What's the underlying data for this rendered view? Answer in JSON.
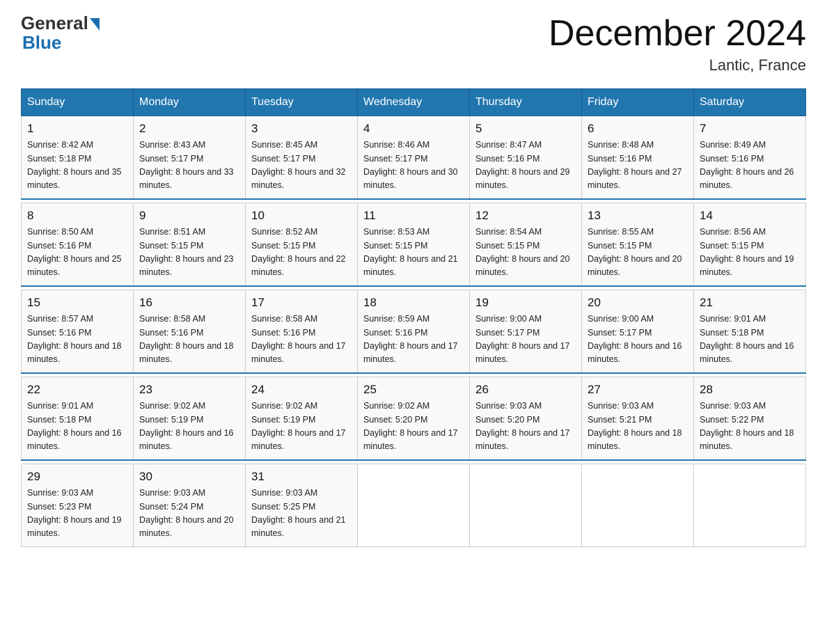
{
  "logo": {
    "general": "General",
    "blue": "Blue"
  },
  "title": "December 2024",
  "subtitle": "Lantic, France",
  "days_header": [
    "Sunday",
    "Monday",
    "Tuesday",
    "Wednesday",
    "Thursday",
    "Friday",
    "Saturday"
  ],
  "weeks": [
    [
      {
        "num": "1",
        "sunrise": "8:42 AM",
        "sunset": "5:18 PM",
        "daylight": "8 hours and 35 minutes."
      },
      {
        "num": "2",
        "sunrise": "8:43 AM",
        "sunset": "5:17 PM",
        "daylight": "8 hours and 33 minutes."
      },
      {
        "num": "3",
        "sunrise": "8:45 AM",
        "sunset": "5:17 PM",
        "daylight": "8 hours and 32 minutes."
      },
      {
        "num": "4",
        "sunrise": "8:46 AM",
        "sunset": "5:17 PM",
        "daylight": "8 hours and 30 minutes."
      },
      {
        "num": "5",
        "sunrise": "8:47 AM",
        "sunset": "5:16 PM",
        "daylight": "8 hours and 29 minutes."
      },
      {
        "num": "6",
        "sunrise": "8:48 AM",
        "sunset": "5:16 PM",
        "daylight": "8 hours and 27 minutes."
      },
      {
        "num": "7",
        "sunrise": "8:49 AM",
        "sunset": "5:16 PM",
        "daylight": "8 hours and 26 minutes."
      }
    ],
    [
      {
        "num": "8",
        "sunrise": "8:50 AM",
        "sunset": "5:16 PM",
        "daylight": "8 hours and 25 minutes."
      },
      {
        "num": "9",
        "sunrise": "8:51 AM",
        "sunset": "5:15 PM",
        "daylight": "8 hours and 23 minutes."
      },
      {
        "num": "10",
        "sunrise": "8:52 AM",
        "sunset": "5:15 PM",
        "daylight": "8 hours and 22 minutes."
      },
      {
        "num": "11",
        "sunrise": "8:53 AM",
        "sunset": "5:15 PM",
        "daylight": "8 hours and 21 minutes."
      },
      {
        "num": "12",
        "sunrise": "8:54 AM",
        "sunset": "5:15 PM",
        "daylight": "8 hours and 20 minutes."
      },
      {
        "num": "13",
        "sunrise": "8:55 AM",
        "sunset": "5:15 PM",
        "daylight": "8 hours and 20 minutes."
      },
      {
        "num": "14",
        "sunrise": "8:56 AM",
        "sunset": "5:15 PM",
        "daylight": "8 hours and 19 minutes."
      }
    ],
    [
      {
        "num": "15",
        "sunrise": "8:57 AM",
        "sunset": "5:16 PM",
        "daylight": "8 hours and 18 minutes."
      },
      {
        "num": "16",
        "sunrise": "8:58 AM",
        "sunset": "5:16 PM",
        "daylight": "8 hours and 18 minutes."
      },
      {
        "num": "17",
        "sunrise": "8:58 AM",
        "sunset": "5:16 PM",
        "daylight": "8 hours and 17 minutes."
      },
      {
        "num": "18",
        "sunrise": "8:59 AM",
        "sunset": "5:16 PM",
        "daylight": "8 hours and 17 minutes."
      },
      {
        "num": "19",
        "sunrise": "9:00 AM",
        "sunset": "5:17 PM",
        "daylight": "8 hours and 17 minutes."
      },
      {
        "num": "20",
        "sunrise": "9:00 AM",
        "sunset": "5:17 PM",
        "daylight": "8 hours and 16 minutes."
      },
      {
        "num": "21",
        "sunrise": "9:01 AM",
        "sunset": "5:18 PM",
        "daylight": "8 hours and 16 minutes."
      }
    ],
    [
      {
        "num": "22",
        "sunrise": "9:01 AM",
        "sunset": "5:18 PM",
        "daylight": "8 hours and 16 minutes."
      },
      {
        "num": "23",
        "sunrise": "9:02 AM",
        "sunset": "5:19 PM",
        "daylight": "8 hours and 16 minutes."
      },
      {
        "num": "24",
        "sunrise": "9:02 AM",
        "sunset": "5:19 PM",
        "daylight": "8 hours and 17 minutes."
      },
      {
        "num": "25",
        "sunrise": "9:02 AM",
        "sunset": "5:20 PM",
        "daylight": "8 hours and 17 minutes."
      },
      {
        "num": "26",
        "sunrise": "9:03 AM",
        "sunset": "5:20 PM",
        "daylight": "8 hours and 17 minutes."
      },
      {
        "num": "27",
        "sunrise": "9:03 AM",
        "sunset": "5:21 PM",
        "daylight": "8 hours and 18 minutes."
      },
      {
        "num": "28",
        "sunrise": "9:03 AM",
        "sunset": "5:22 PM",
        "daylight": "8 hours and 18 minutes."
      }
    ],
    [
      {
        "num": "29",
        "sunrise": "9:03 AM",
        "sunset": "5:23 PM",
        "daylight": "8 hours and 19 minutes."
      },
      {
        "num": "30",
        "sunrise": "9:03 AM",
        "sunset": "5:24 PM",
        "daylight": "8 hours and 20 minutes."
      },
      {
        "num": "31",
        "sunrise": "9:03 AM",
        "sunset": "5:25 PM",
        "daylight": "8 hours and 21 minutes."
      },
      null,
      null,
      null,
      null
    ]
  ]
}
